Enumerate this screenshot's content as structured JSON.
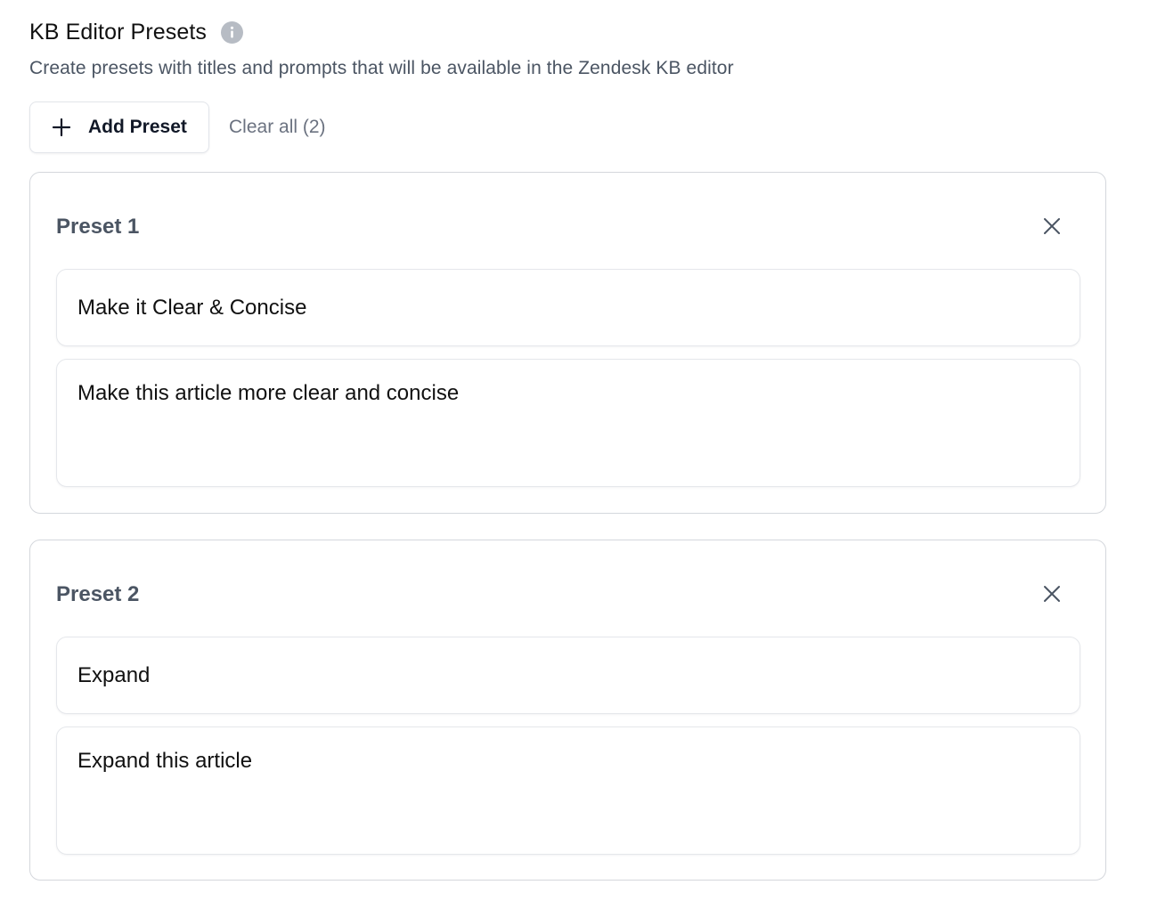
{
  "header": {
    "title": "KB Editor Presets",
    "subtitle": "Create presets with titles and prompts that will be available in the Zendesk KB editor",
    "info_icon": "info-icon"
  },
  "actions": {
    "add_label": "Add Preset",
    "add_icon": "plus-icon",
    "clear_label": "Clear all (2)"
  },
  "presets": [
    {
      "heading": "Preset 1",
      "title_value": "Make it Clear & Concise",
      "prompt_value": "Make this article more clear and concise",
      "close_icon": "close-icon"
    },
    {
      "heading": "Preset 2",
      "title_value": "Expand",
      "prompt_value": "Expand this article",
      "close_icon": "close-icon"
    }
  ],
  "colors": {
    "text_primary": "#111827",
    "text_muted": "#4b5563",
    "border": "#d4d7dc",
    "info_icon_bg": "#b7bcc4"
  }
}
